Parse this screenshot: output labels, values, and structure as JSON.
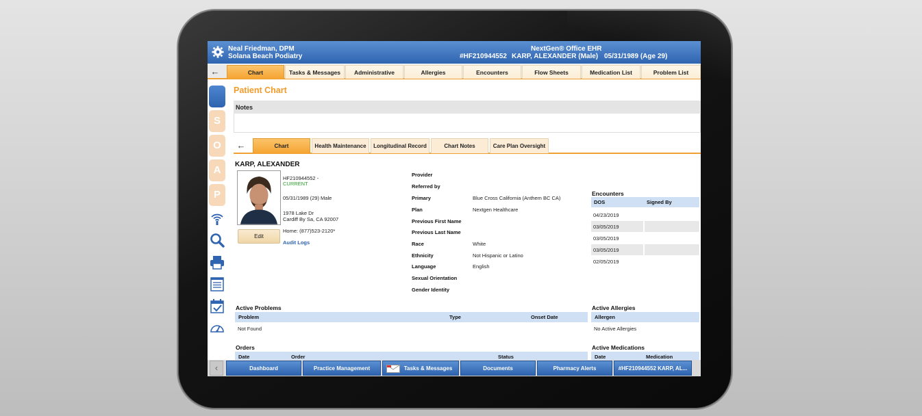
{
  "header": {
    "provider_name": "Neal Friedman, DPM",
    "practice": "Solana Beach Podiatry",
    "patient_id": "#HF210944552",
    "app_name": "NextGen® Office EHR",
    "patient_name_sex": "KARP, ALEXANDER  (Male)",
    "dob_age": "05/31/1989  (Age 29)"
  },
  "main_tabs": [
    "Chart",
    "Tasks & Messages",
    "Administrative",
    "Allergies",
    "Encounters",
    "Flow Sheets",
    "Medication List",
    "Problem List"
  ],
  "sidebar": {
    "soap": [
      "S",
      "O",
      "A",
      "P"
    ]
  },
  "page_title": "Patient Chart",
  "notes_label": "Notes",
  "sub_tabs": [
    "Chart",
    "Health Maintenance",
    "Longitudinal Record",
    "Chart Notes",
    "Care Plan Oversight"
  ],
  "patient": {
    "name": "KARP, ALEXANDER",
    "id_line": "HF210944552 -",
    "status": "CURRENT",
    "dob_line": "05/31/1989 (29) Male",
    "address1": "1978 Lake Dr",
    "address2": "Cardiff By Sa, CA 92007",
    "phone": "Home: (877)523-2120*",
    "audit_logs": "Audit Logs",
    "edit_label": "Edit"
  },
  "details": {
    "labels": [
      "Provider",
      "Referred by",
      "Primary",
      "Plan",
      "Previous First Name",
      "Previous Last Name",
      "Race",
      "Ethnicity",
      "Language",
      "Sexual Orientation",
      "Gender Identity"
    ],
    "primary": "Blue Cross California (Anthem BC CA)",
    "plan": "Nextgen Healthcare",
    "race": "White",
    "ethnicity": "Not Hispanic or Latino",
    "language": "English"
  },
  "encounters": {
    "title": "Encounters",
    "col_dos": "DOS",
    "col_signed": "Signed By",
    "dates": [
      "04/23/2019",
      "03/05/2019",
      "03/05/2019",
      "03/05/2019",
      "02/05/2019"
    ]
  },
  "active_problems": {
    "title": "Active Problems",
    "col_problem": "Problem",
    "col_type": "Type",
    "col_onset": "Onset Date",
    "empty": "Not Found"
  },
  "active_allergies": {
    "title": "Active Allergies",
    "col_allergen": "Allergen",
    "empty": "No Active Allergies"
  },
  "orders": {
    "title": "Orders",
    "col_date": "Date",
    "col_order": "Order",
    "col_status": "Status"
  },
  "active_medications": {
    "title": "Active Medications",
    "col_date": "Date",
    "col_medication": "Medication"
  },
  "bottom_bar": [
    "Dashboard",
    "Practice Management",
    "Tasks & Messages",
    "Documents",
    "Pharmacy Alerts",
    "#HF210944552  KARP, AL..."
  ],
  "icons": [
    "gear-icon",
    "back-arrow-icon",
    "wireless-icon",
    "search-icon",
    "printer-icon",
    "document-icon",
    "calendar-check-icon",
    "gauge-icon",
    "mail-icon"
  ]
}
